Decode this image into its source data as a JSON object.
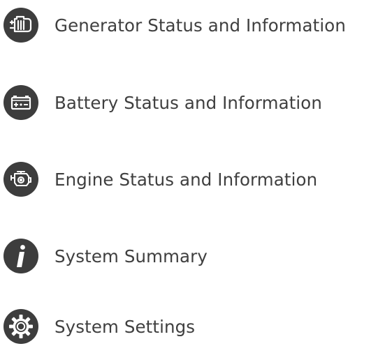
{
  "menu": {
    "items": [
      {
        "label": "Generator Status and Information",
        "icon": "generator-icon"
      },
      {
        "label": "Battery Status and Information",
        "icon": "battery-icon"
      },
      {
        "label": "Engine Status and Information",
        "icon": "engine-icon"
      },
      {
        "label": "System Summary",
        "icon": "info-icon"
      },
      {
        "label": "System Settings",
        "icon": "gear-icon"
      }
    ]
  },
  "colors": {
    "icon_background": "#3d3d3d",
    "icon_glyph": "#ffffff",
    "label_text": "#3f3f3f"
  }
}
